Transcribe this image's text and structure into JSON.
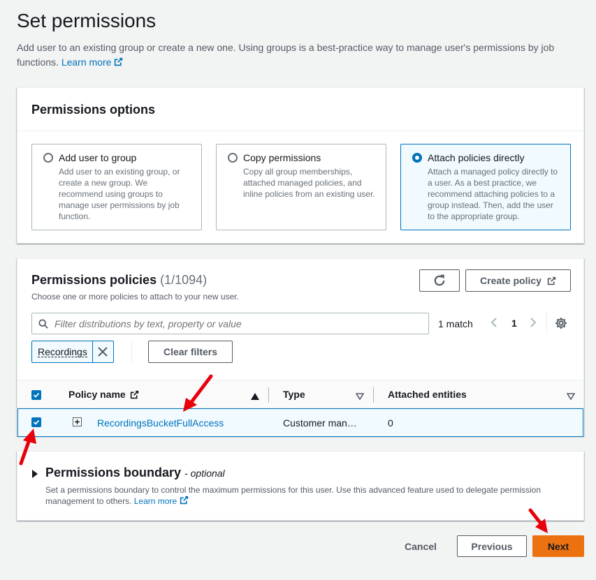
{
  "page": {
    "title": "Set permissions",
    "description": "Add user to an existing group or create a new one. Using groups is a best-practice way to manage user's permissions by job functions.",
    "learn_more": "Learn more"
  },
  "permissions_options": {
    "title": "Permissions options",
    "options": [
      {
        "label": "Add user to group",
        "description": "Add user to an existing group, or create a new group. We recommend using groups to manage user permissions by job function.",
        "selected": false
      },
      {
        "label": "Copy permissions",
        "description": "Copy all group memberships, attached managed policies, and inline policies from an existing user.",
        "selected": false
      },
      {
        "label": "Attach policies directly",
        "description": "Attach a managed policy directly to a user. As a best practice, we recommend attaching policies to a group instead. Then, add the user to the appropriate group.",
        "selected": true
      }
    ]
  },
  "policies": {
    "title": "Permissions policies",
    "count": "(1/1094)",
    "subtitle": "Choose one or more policies to attach to your new user.",
    "refresh_icon": "refresh-icon",
    "create_policy_label": "Create policy",
    "search_placeholder": "Filter distributions by text, property or value",
    "match_text": "1 match",
    "page_number": "1",
    "filter_token": "Recordings",
    "clear_filters_label": "Clear filters",
    "columns": {
      "policy_name": "Policy name",
      "type": "Type",
      "attached_entities": "Attached entities"
    },
    "rows": [
      {
        "policy_name": "RecordingsBucketFullAccess",
        "type": "Customer man…",
        "attached_entities": "0",
        "selected": true
      }
    ]
  },
  "boundary": {
    "title": "Permissions boundary",
    "optional": "- optional",
    "description": "Set a permissions boundary to control the maximum permissions for this user. Use this advanced feature used to delegate permission management to others.",
    "learn_more": "Learn more"
  },
  "footer": {
    "cancel_label": "Cancel",
    "previous_label": "Previous",
    "next_label": "Next"
  },
  "colors": {
    "accent": "#0073bb",
    "primary_button": "#ec7211",
    "annotation_arrow": "#e8000b"
  }
}
